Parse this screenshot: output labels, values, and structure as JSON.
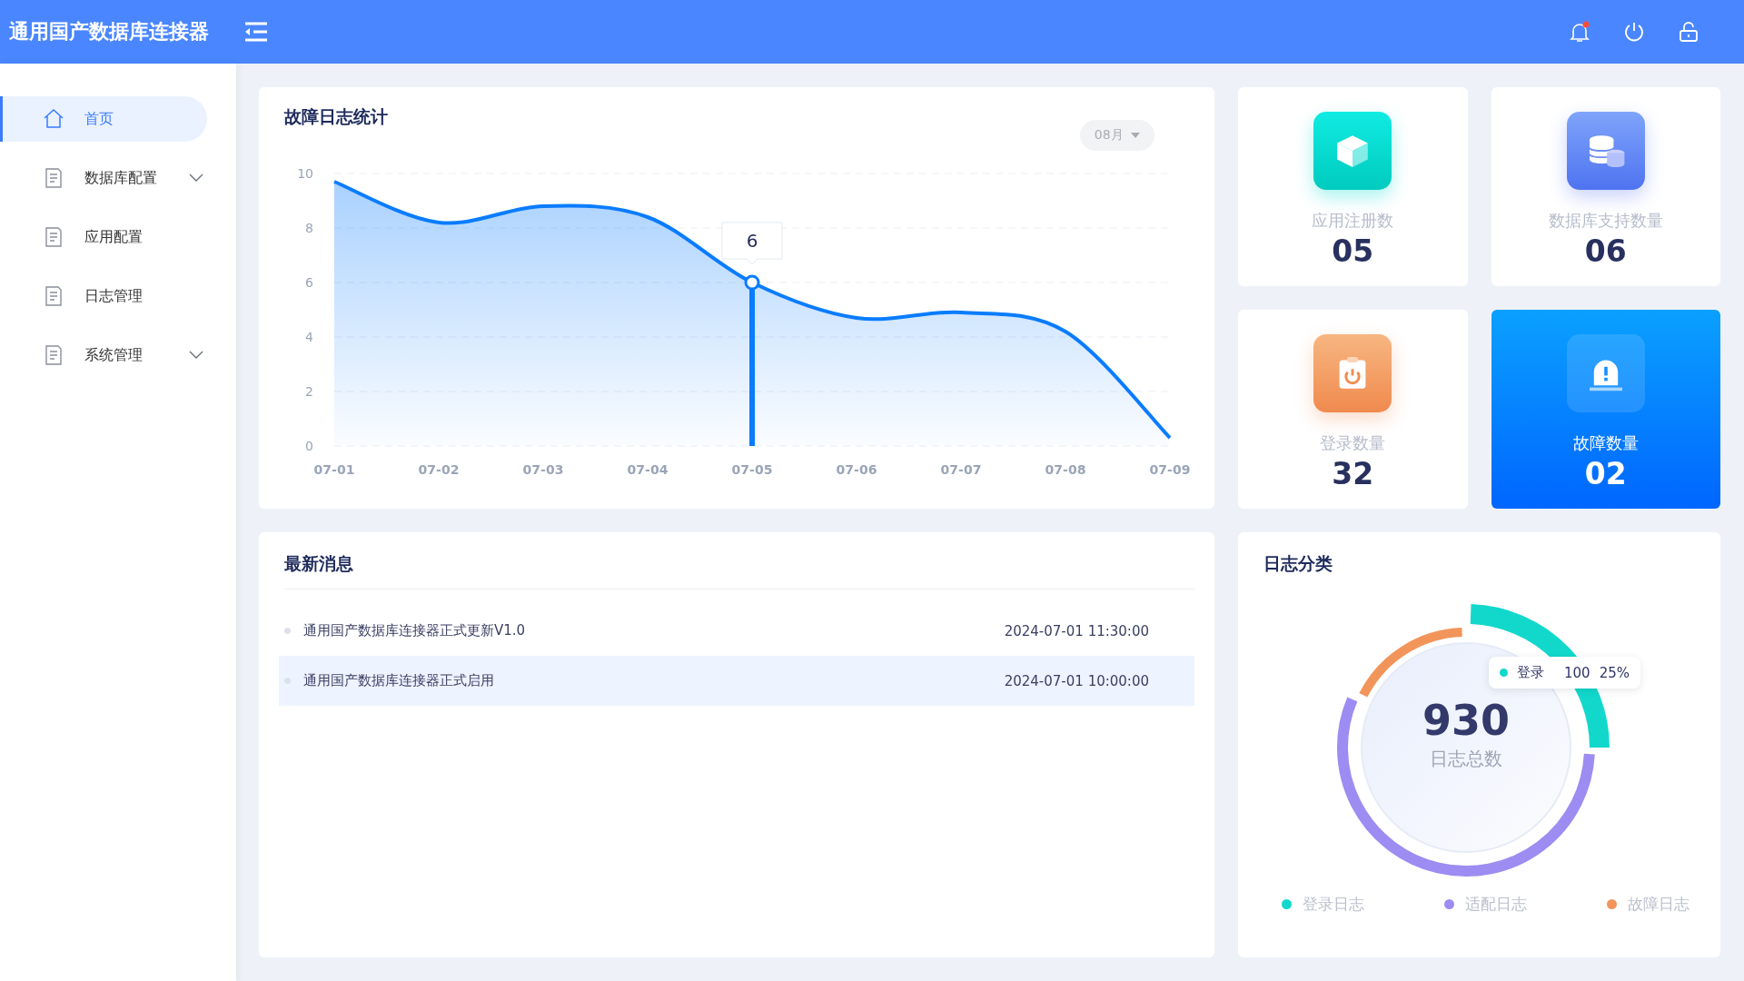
{
  "header": {
    "title": "通用国产数据库连接器",
    "notification_dot": true
  },
  "sidebar": {
    "items": [
      {
        "label": "首页",
        "kind": "home",
        "selected": true
      },
      {
        "label": "数据库配置",
        "kind": "doc",
        "selected": false,
        "expandable": true,
        "expanded": false
      },
      {
        "label": "应用配置",
        "kind": "doc",
        "selected": false
      },
      {
        "label": "日志管理",
        "kind": "doc",
        "selected": false
      },
      {
        "label": "系统管理",
        "kind": "doc",
        "selected": false,
        "expandable": true,
        "expanded": false
      }
    ]
  },
  "fault_chart": {
    "title": "故障日志统计",
    "month_select": "08月",
    "chart_data": {
      "type": "area",
      "categories": [
        "07-01",
        "07-02",
        "07-03",
        "07-04",
        "07-05",
        "07-06",
        "07-07",
        "07-08",
        "07-09"
      ],
      "series": [
        {
          "color": "#0a7cff",
          "values": [
            9.7,
            8.2,
            8.8,
            8.4,
            6,
            4.7,
            4.9,
            4.2,
            0.3
          ]
        }
      ],
      "ylim": [
        0,
        10
      ],
      "yticks": [
        0,
        2,
        4,
        6,
        8,
        10
      ],
      "grid": true,
      "annotations": [
        "6"
      ]
    }
  },
  "stats": [
    {
      "label": "应用注册数",
      "value": "05",
      "kind": "cube",
      "highlighted": false
    },
    {
      "label": "数据库支持数量",
      "value": "06",
      "kind": "database",
      "highlighted": false
    },
    {
      "label": "登录数量",
      "value": "32",
      "kind": "login",
      "highlighted": false
    },
    {
      "label": "故障数量",
      "value": "02",
      "kind": "alarm",
      "highlighted": true
    }
  ],
  "messages": {
    "title": "最新消息",
    "items": [
      {
        "text": "通用国产数据库连接器正式更新V1.0",
        "time": "2024-07-01 11:30:00",
        "highlighted": false
      },
      {
        "text": "通用国产数据库连接器正式启用",
        "time": "2024-07-01 10:00:00",
        "highlighted": true
      }
    ]
  },
  "log_categories": {
    "title": "日志分类",
    "total": "930",
    "total_label": "日志总数",
    "tooltip": {
      "label": "登录",
      "value": "100",
      "percent": "25%"
    },
    "legend": [
      {
        "label": "登录日志",
        "color": "#12d8cc"
      },
      {
        "label": "适配日志",
        "color": "#9d8cf2"
      },
      {
        "label": "故障日志",
        "color": "#f2955a"
      }
    ]
  }
}
